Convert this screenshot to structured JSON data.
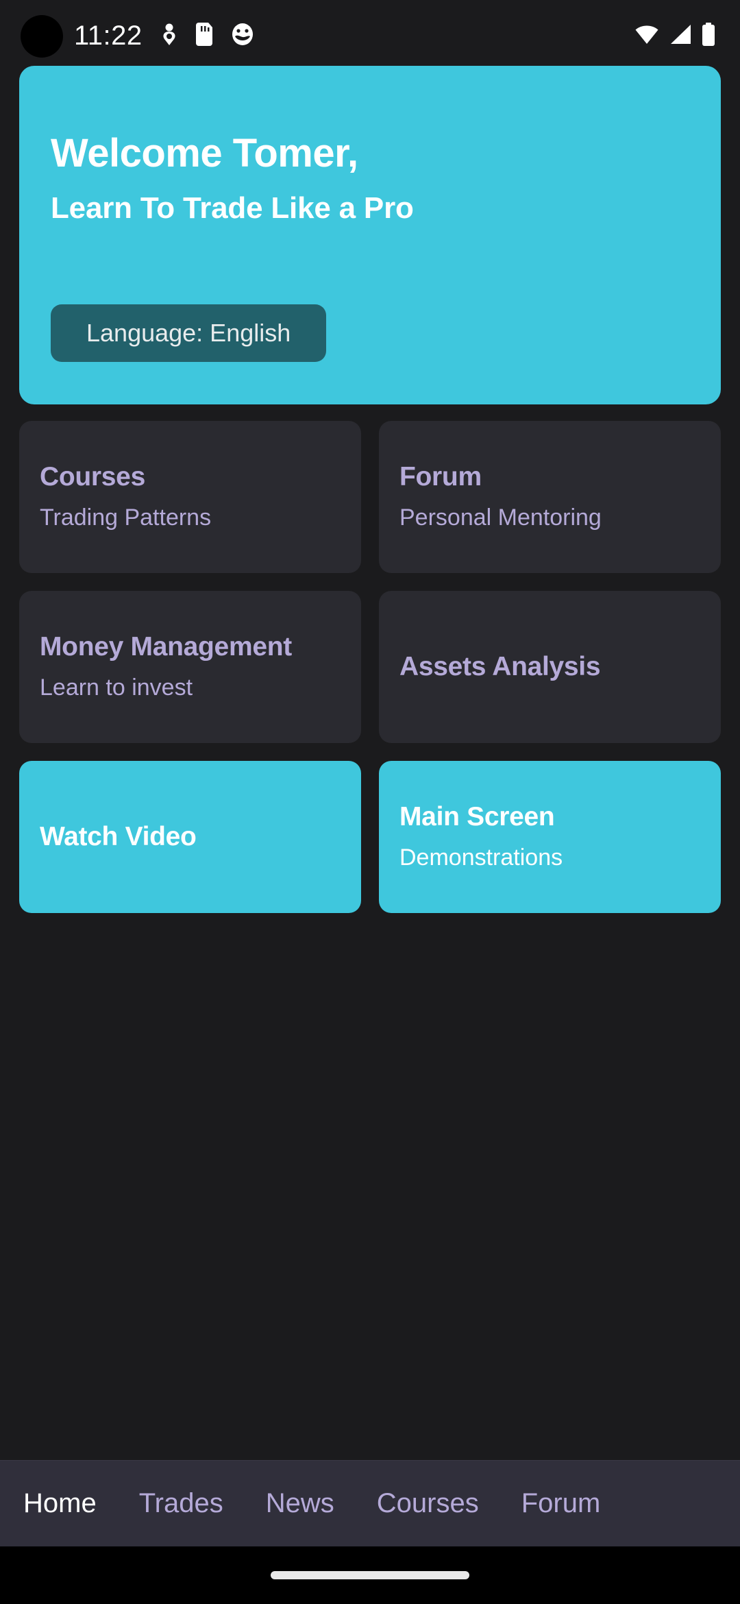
{
  "statusbar": {
    "time": "11:22",
    "icons_left": [
      "person-pin-icon",
      "sd-card-icon",
      "emoji-face-icon"
    ],
    "icons_right": [
      "wifi-icon",
      "cellular-signal-icon",
      "battery-icon"
    ]
  },
  "brand": {
    "logo_name": "trader-flag-diamond-logo",
    "logo_colors": {
      "dark": "#3a3a3d",
      "red": "#c4161c",
      "figure": "#ffffff"
    }
  },
  "hero": {
    "title": "Welcome Tomer,",
    "subtitle": "Learn To Trade Like a Pro",
    "language_button": "Language: English",
    "bg_color": "#3fc7dd",
    "button_color": "#22616b"
  },
  "grid": {
    "cards": [
      {
        "title": "Courses",
        "subtitle": "Trading Patterns",
        "accent": false
      },
      {
        "title": "Forum",
        "subtitle": "Personal Mentoring",
        "accent": false
      },
      {
        "title": "Money Management",
        "subtitle": "Learn to invest",
        "accent": false
      },
      {
        "title": "Assets Analysis",
        "subtitle": "",
        "accent": false
      },
      {
        "title": "Watch Video",
        "subtitle": "",
        "accent": true
      },
      {
        "title": "Main Screen",
        "subtitle": "Demonstrations",
        "accent": true
      }
    ],
    "card_bg": "#2a2a30",
    "card_text": "#b5aad8",
    "accent_bg": "#3fc7dd"
  },
  "bottomnav": {
    "items": [
      {
        "label": "Home",
        "active": true
      },
      {
        "label": "Trades",
        "active": false
      },
      {
        "label": "News",
        "active": false
      },
      {
        "label": "Courses",
        "active": false
      },
      {
        "label": "Forum",
        "active": false
      }
    ],
    "bg_color": "#302f3b",
    "active_color": "#ffffff",
    "inactive_color": "#b5aad8"
  }
}
